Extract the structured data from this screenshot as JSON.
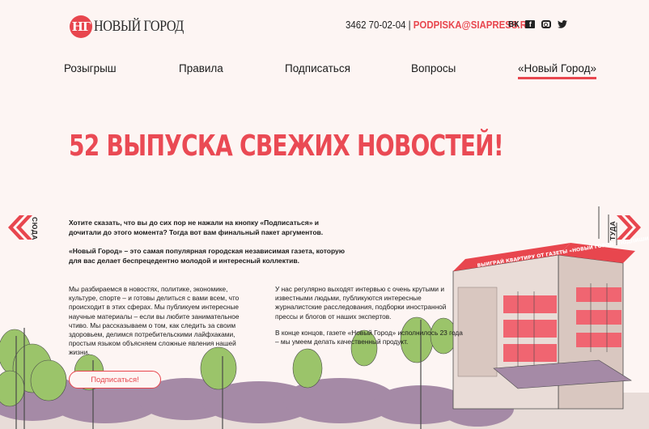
{
  "header": {
    "logo_mark": "НГ",
    "logo_text": "НОВЫЙ ГОРОД",
    "phone": "3462 70-02-04",
    "separator": "|",
    "email": "PODPISKA@SIAPRESS.RU",
    "social": [
      "vk-icon",
      "facebook-icon",
      "instagram-icon",
      "twitter-icon"
    ]
  },
  "nav": {
    "items": [
      {
        "label": "Розыгрыш"
      },
      {
        "label": "Правила"
      },
      {
        "label": "Подписаться"
      },
      {
        "label": "Вопросы"
      },
      {
        "label": "«Новый Город»"
      }
    ],
    "active_index": 4
  },
  "headline": "52 ВЫПУСКА СВЕЖИХ НОВОСТЕЙ!",
  "arrows": {
    "left_label": "СЮДА",
    "right_label": "ТУДА"
  },
  "intro": {
    "p1": "Хотите сказать, что вы до сих пор не нажали на кнопку «Подписаться» и дочитали до этого момента? Тогда вот вам финальный пакет аргументов.",
    "p2": "«Новый Город» – это самая популярная городская независимая газета, которую для вас делает беспрецедентно молодой и интересный коллектив."
  },
  "col1": {
    "p1": "Мы разбираемся в новостях, политике, экономике, культуре, спорте – и готовы делиться с вами всем, что происходит в этих сферах. Мы публикуем интересные научные материалы – если вы любите занимательное чтиво. Мы рассказываем о том, как следить за своим здоровьем, делимся потребительскими лайфхаками, простым языком объясняем сложные явления нашей жизни."
  },
  "col2": {
    "p1": "У нас регулярно выходят интервью с очень крутыми и известными людьми, публикуются интересные журналистские расследования, подборки иностранной прессы и блогов от наших экспертов.",
    "p2": "В конце концов, газете «Новый Город» исполнилось 23 года – мы умеем делать качественный продукт."
  },
  "banner": {
    "roof_text": "ВЫИГРАЙ КВАРТИРУ ОТ ГАЗЕТЫ «НОВЫЙ ГОРОД» ПОДПИШИСЬ"
  },
  "subscribe_button": "Подписаться!",
  "colors": {
    "accent": "#e8464e",
    "background": "#fdf5f3",
    "tree_green": "#9bc46a",
    "tree_purple": "#a58aa6",
    "building": "#d9c7c0"
  }
}
